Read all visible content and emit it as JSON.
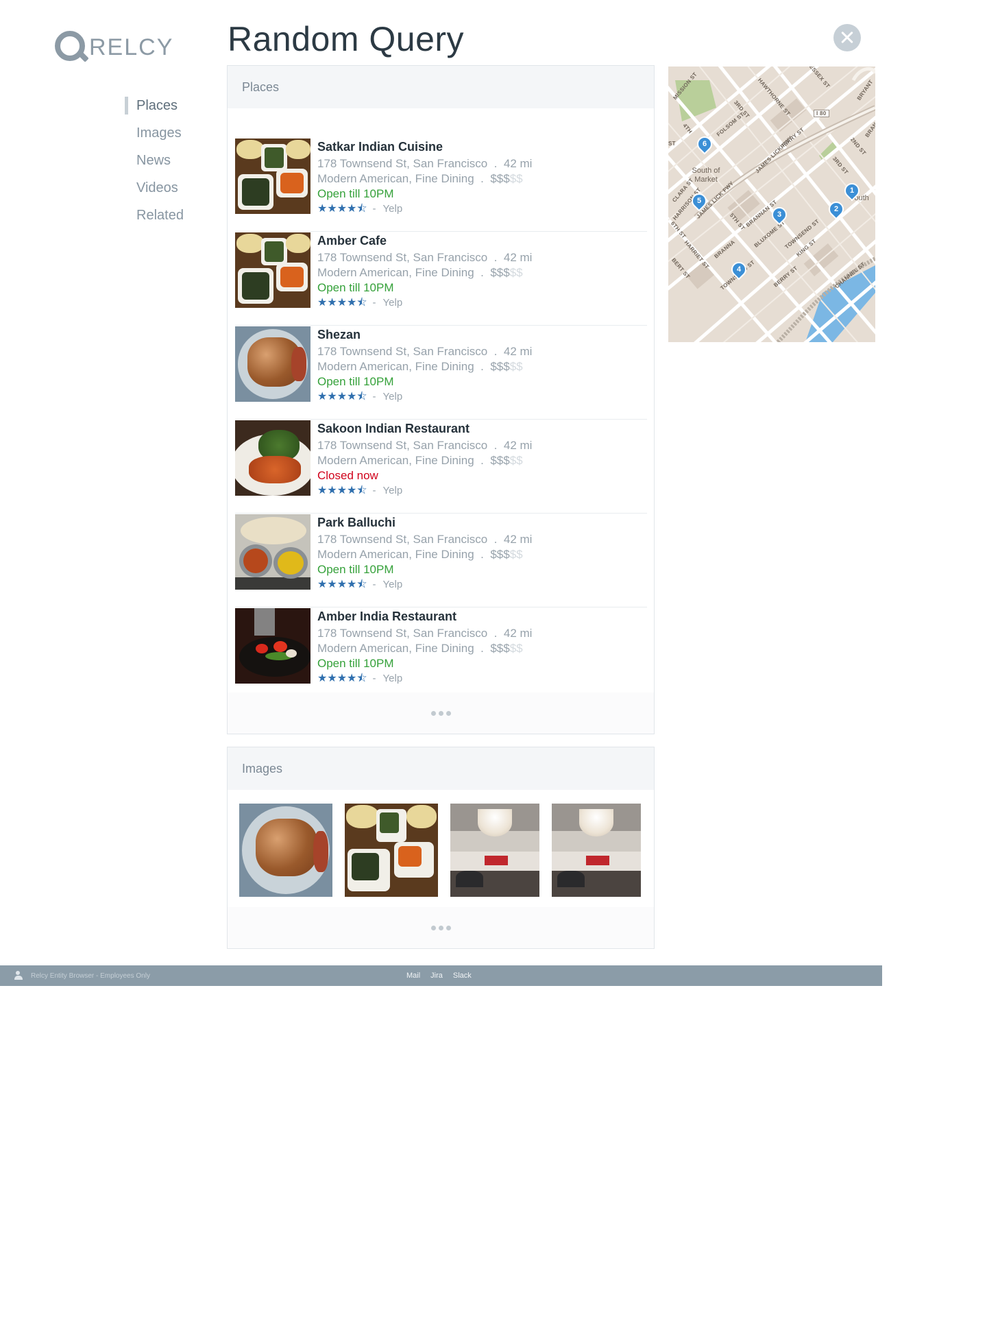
{
  "app": {
    "logo_text": "RELCY",
    "page_title": "Random Query"
  },
  "sidebar": {
    "items": [
      {
        "label": "Places",
        "active": true
      },
      {
        "label": "Images",
        "active": false
      },
      {
        "label": "News",
        "active": false
      },
      {
        "label": "Videos",
        "active": false
      },
      {
        "label": "Related",
        "active": false
      }
    ]
  },
  "places_panel": {
    "title": "Places",
    "items": [
      {
        "name": "Satkar Indian Cuisine",
        "address": "178 Townsend St, San Francisco",
        "distance": "42 mi",
        "category": "Modern American, Fine Dining",
        "price_on": "$$$",
        "price_off": "$$",
        "status": "Open till 10PM",
        "status_type": "open",
        "rating": 4.5,
        "source": "Yelp",
        "image": "curry-bowls"
      },
      {
        "name": "Amber Cafe",
        "address": "178 Townsend St, San Francisco",
        "distance": "42 mi",
        "category": "Modern American, Fine Dining",
        "price_on": "$$$",
        "price_off": "$$",
        "status": "Open till 10PM",
        "status_type": "open",
        "rating": 4.5,
        "source": "Yelp",
        "image": "curry-bowls"
      },
      {
        "name": "Shezan",
        "address": "178 Townsend St, San Francisco",
        "distance": "42 mi",
        "category": "Modern American, Fine Dining",
        "price_on": "$$$",
        "price_off": "$$",
        "status": "Open till 10PM",
        "status_type": "open",
        "rating": 4.5,
        "source": "Yelp",
        "image": "plated-meat"
      },
      {
        "name": "Sakoon Indian Restaurant",
        "address": "178 Townsend St, San Francisco",
        "distance": "42 mi",
        "category": "Modern American, Fine Dining",
        "price_on": "$$$",
        "price_off": "$$",
        "status": "Closed now",
        "status_type": "closed",
        "rating": 4.5,
        "source": "Yelp",
        "image": "greens-curry"
      },
      {
        "name": "Park Balluchi",
        "address": "178 Townsend St, San Francisco",
        "distance": "42 mi",
        "category": "Modern American, Fine Dining",
        "price_on": "$$$",
        "price_off": "$$",
        "status": "Open till 10PM",
        "status_type": "open",
        "rating": 4.5,
        "source": "Yelp",
        "image": "thali"
      },
      {
        "name": "Amber India Restaurant",
        "address": "178 Townsend St, San Francisco",
        "distance": "42 mi",
        "category": "Modern American, Fine Dining",
        "price_on": "$$$",
        "price_off": "$$",
        "status": "Open till 10PM",
        "status_type": "open",
        "rating": 4.5,
        "source": "Yelp",
        "image": "sizzler"
      }
    ],
    "separator": ".",
    "rating_separator": "-"
  },
  "images_panel": {
    "title": "Images",
    "images": [
      "plated-meat",
      "curry-bowls",
      "restaurant-interior",
      "restaurant-interior"
    ]
  },
  "map": {
    "pins": [
      "1",
      "2",
      "3",
      "4",
      "5",
      "6"
    ],
    "street_labels": [
      "MISSION ST",
      "HAWTHORNE ST",
      "ESSEX ST",
      "BRYANT",
      "I 80",
      "3RD ST",
      "4TH",
      "FOLSOM ST",
      "PERRY ST",
      "2ND ST",
      "BRAN",
      "JAMES LICK FWY",
      "3RD ST",
      "CLARA ST",
      "HARRISON ST",
      "JAMES LICK FWY",
      "5TH ST",
      "BRANNAN ST",
      "6TH ST",
      "BLUXOME ST",
      "TOWNSEND ST",
      "KING ST",
      "BRANNA",
      "HARRIET ST",
      "BERT ST",
      "TOWNSEND ST",
      "BERRY ST",
      "CHANNEL ST",
      "ST"
    ],
    "place_labels": [
      "South of Market",
      "South"
    ]
  },
  "footer": {
    "brand": "Relcy Entity Browser - Employees Only",
    "links": [
      "Mail",
      "Jira",
      "Slack"
    ]
  },
  "colors": {
    "accent": "#2f6fae",
    "open": "#35a13a",
    "closed": "#d0021b",
    "footer_bg": "#8b9ca8",
    "pin": "#3b8fd6"
  },
  "icons": [
    "relcy-logo-icon",
    "close-icon",
    "star-icon",
    "more-dots-icon",
    "map-pin-icon",
    "user-icon"
  ]
}
